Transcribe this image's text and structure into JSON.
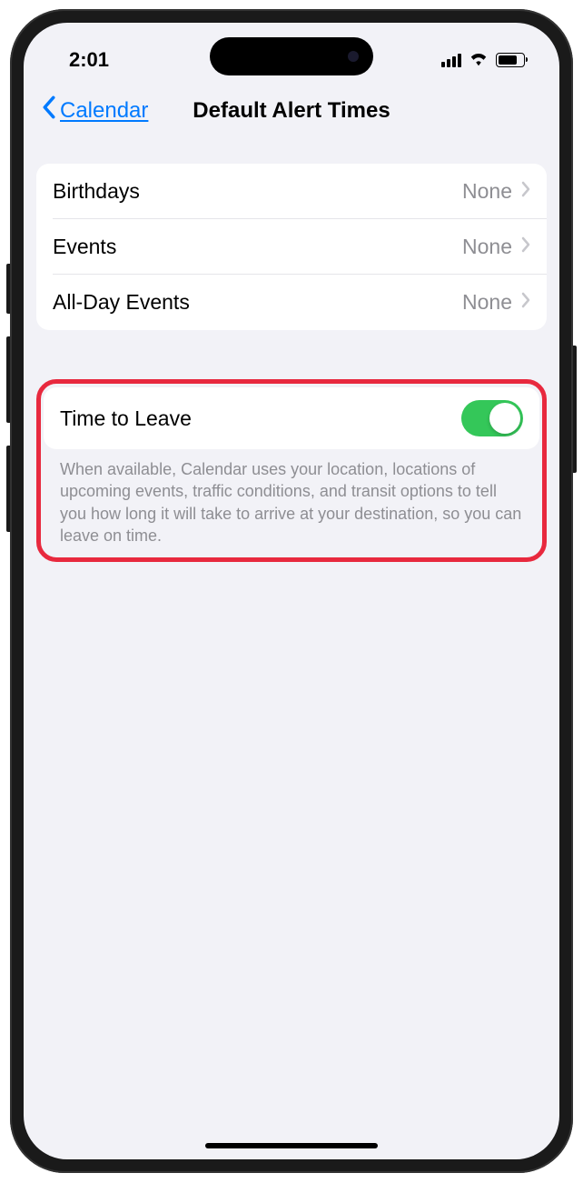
{
  "status": {
    "time": "2:01"
  },
  "nav": {
    "back_label": "Calendar",
    "title": "Default Alert Times"
  },
  "alerts": [
    {
      "label": "Birthdays",
      "value": "None"
    },
    {
      "label": "Events",
      "value": "None"
    },
    {
      "label": "All-Day Events",
      "value": "None"
    }
  ],
  "timeToLeave": {
    "label": "Time to Leave",
    "enabled": true,
    "description": "When available, Calendar uses your location, locations of upcoming events, traffic conditions, and transit options to tell you how long it will take to arrive at your destination, so you can leave on time."
  }
}
